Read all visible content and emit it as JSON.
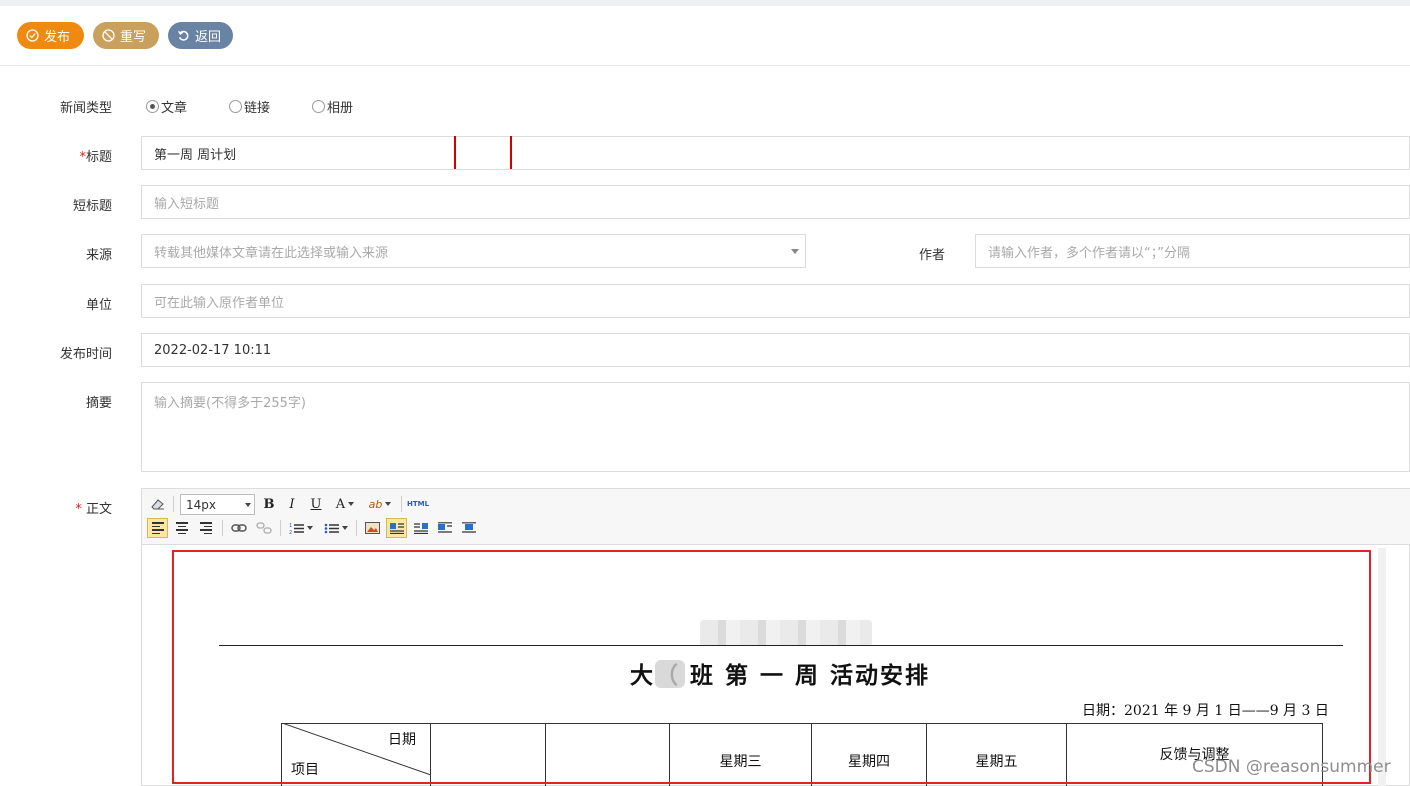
{
  "toolbar": {
    "publish": "发布",
    "rewrite": "重写",
    "back": "返回",
    "colors": {
      "publish": "#ef8a10",
      "rewrite": "#c9a15d",
      "back": "#6983a5"
    }
  },
  "form": {
    "news_type": {
      "label": "新闻类型",
      "options": [
        "文章",
        "链接",
        "相册"
      ],
      "selected": "文章"
    },
    "title": {
      "required_mark": "*",
      "label": "标题",
      "value": "第一周 周计划"
    },
    "short_title": {
      "label": "短标题",
      "placeholder": "输入短标题"
    },
    "source": {
      "label": "来源",
      "placeholder": "转载其他媒体文章请在此选择或输入来源"
    },
    "author": {
      "label": "作者",
      "placeholder": "请输入作者，多个作者请以“；”分隔"
    },
    "unit": {
      "label": "单位",
      "placeholder": "可在此输入原作者单位"
    },
    "publish_time": {
      "label": "发布时间",
      "value": "2022-02-17 10:11"
    },
    "summary": {
      "label": "摘要",
      "placeholder": "输入摘要(不得多于255字)"
    },
    "body": {
      "required_mark": "*",
      "label": "正文"
    }
  },
  "editor": {
    "font_size": "14px",
    "bold": "B",
    "italic": "I",
    "underline": "U",
    "font_color": "A",
    "highlight": "ab",
    "html": "HTML",
    "icons": [
      "eraser-icon",
      "align-left-icon",
      "align-center-icon",
      "align-right-icon",
      "link-icon",
      "unlink-icon",
      "ordered-list-icon",
      "unordered-list-icon",
      "image-icon",
      "float-left-icon",
      "float-right-icon",
      "float-none-icon",
      "center-block-icon"
    ]
  },
  "document": {
    "title": "大（   班  第 一 周   活动安排",
    "date_line": "日期：2021 年 9 月 1 日——9 月 3 日",
    "table_header": {
      "diag_top": "日期",
      "diag_bottom": "项目",
      "col3": "星期三",
      "col4": "星期四",
      "col5": "星期五",
      "col6": "反馈与调整"
    }
  },
  "watermark": "CSDN @reasonsummer"
}
